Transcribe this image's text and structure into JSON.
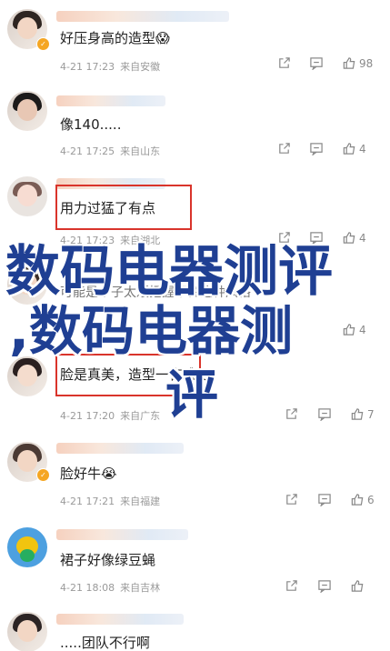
{
  "comments": [
    {
      "text": "好压身高的造型",
      "emoji": "😱",
      "date": "4-21 17:23",
      "loc": "来自安徽",
      "likes": "98"
    },
    {
      "text": "像140.....",
      "emoji": "",
      "date": "4-21 17:25",
      "loc": "来自山东",
      "likes": "4"
    },
    {
      "text": "用力过猛了有点",
      "emoji": "",
      "date": "4-21 17:23",
      "loc": "来自湖北",
      "likes": "4"
    },
    {
      "text": "可能是个子太矮把握不住这种风格",
      "emoji": "",
      "date": "",
      "loc": "",
      "likes": "4"
    },
    {
      "text": "脸是真美，造型一言难尽",
      "emoji": "",
      "date": "4-21 17:20",
      "loc": "来自广东",
      "likes": "7"
    },
    {
      "text": "脸好牛",
      "emoji": "😭",
      "date": "4-21 17:21",
      "loc": "来自福建",
      "likes": "6"
    },
    {
      "text": "裙子好像绿豆蝇",
      "emoji": "",
      "date": "4-21 18:08",
      "loc": "来自吉林",
      "likes": ""
    },
    {
      "text": ".....团队不行啊",
      "emoji": "",
      "date": "",
      "loc": "",
      "likes": ""
    }
  ],
  "overlay": {
    "line1": "数码电器测评",
    "line2": ",数码电器测",
    "line3": "评"
  },
  "colors": {
    "highlight": "#d9342b",
    "overlay": "#1f3f93",
    "verified": "#f5a623"
  }
}
